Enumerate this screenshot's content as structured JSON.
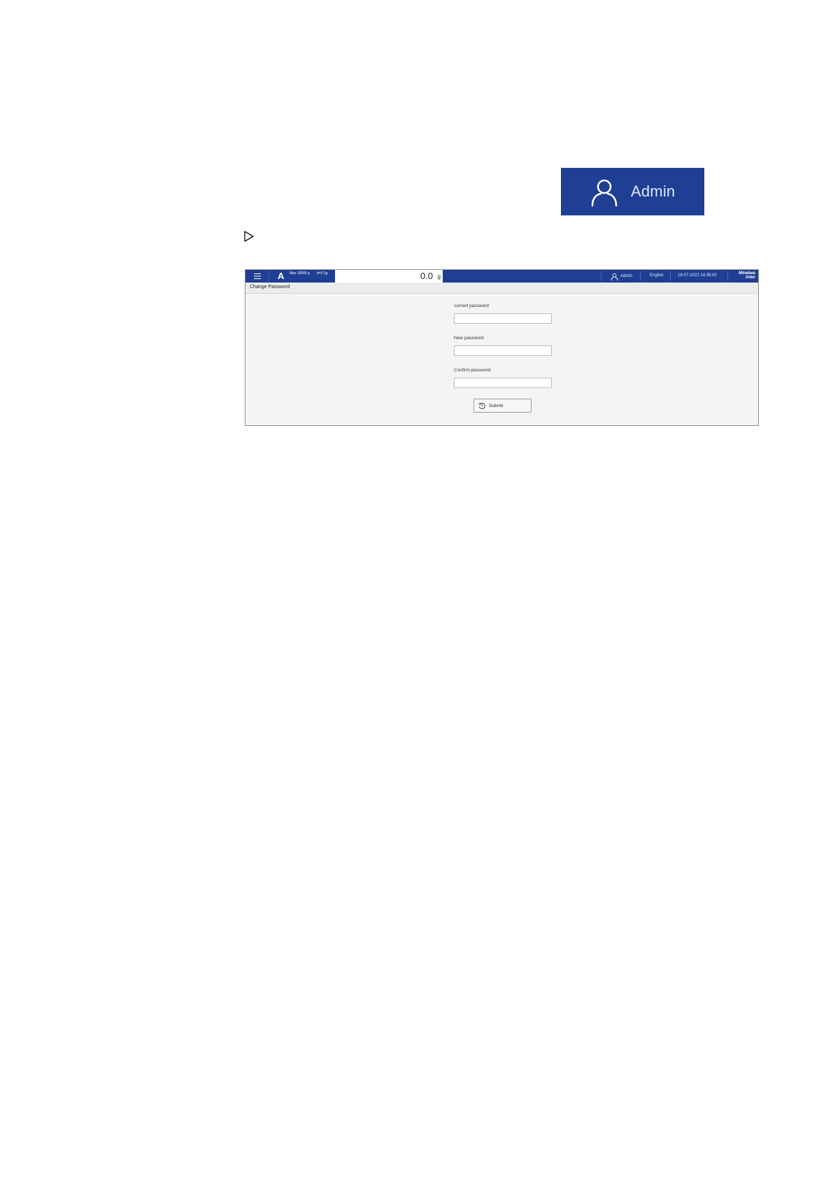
{
  "callout": {
    "user_label": "Admin",
    "user_icon": "user-icon"
  },
  "step": {
    "arrow_icon": "triangle-right-icon"
  },
  "app": {
    "topbar": {
      "menu_icon": "hamburger-menu-icon",
      "scale_id": "A",
      "max_label": "Max 10000 g",
      "d_label": "d=0.1g",
      "weight_value": "0.0",
      "weight_unit": "g",
      "user_name": "Admin",
      "language": "English",
      "datetime": "18-07-2022 14:35:00",
      "brand_line1": "Minebea",
      "brand_line2": "intec",
      "color_primary": "#1f3f94"
    },
    "page_title": "Change Password",
    "form": {
      "current_label": "current password",
      "current_value": "",
      "new_label": "New password",
      "new_value": "",
      "confirm_label": "Confirm password",
      "confirm_value": "",
      "submit_label": "Submit",
      "submit_icon": "submit-refresh-icon"
    }
  }
}
